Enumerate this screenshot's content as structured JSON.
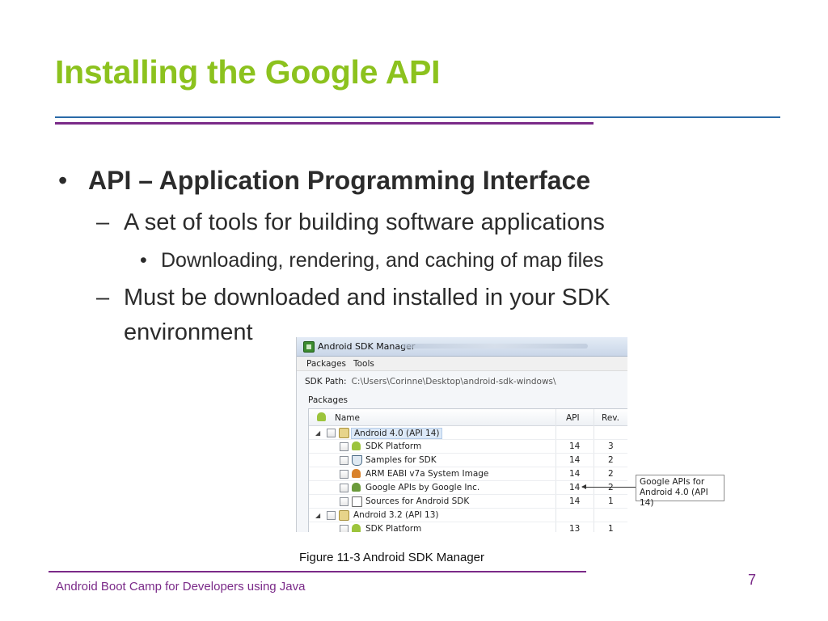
{
  "slide": {
    "title": "Installing the Google API",
    "bullets": {
      "l1": {
        "marker": "•",
        "text": "API – Application Programming Interface"
      },
      "l2a": {
        "marker": "–",
        "text": "A set of tools for building software applications"
      },
      "l3": {
        "marker": "•",
        "text": "Downloading, rendering, and caching of map files"
      },
      "l2b": {
        "marker": "–",
        "text": "Must be downloaded and installed in your SDK",
        "cont": "environment"
      }
    },
    "caption": "Figure 11-3 Android SDK Manager",
    "footer": "Android Boot Camp for Developers using Java",
    "page_number": "7",
    "colors": {
      "title": "#8cc21e",
      "accent_purple": "#7a2a88",
      "accent_blue": "#2a6aa8"
    }
  },
  "sdk_manager": {
    "window_title": "Android SDK Manager",
    "menu": [
      "Packages",
      "Tools"
    ],
    "sdk_path_label": "SDK Path:",
    "sdk_path_value": "C:\\Users\\Corinne\\Desktop\\android-sdk-windows\\",
    "packages_label": "Packages",
    "columns": {
      "name": "Name",
      "api": "API",
      "rev": "Rev."
    },
    "rows": [
      {
        "name": "Android 4.0 (API 14)",
        "api": "",
        "rev": "",
        "icon": "folder-icon",
        "group": true
      },
      {
        "name": "SDK Platform",
        "api": "14",
        "rev": "3",
        "icon": "android-icon"
      },
      {
        "name": "Samples for SDK",
        "api": "14",
        "rev": "2",
        "icon": "flask-icon"
      },
      {
        "name": "ARM EABI v7a System Image",
        "api": "14",
        "rev": "2",
        "icon": "android-icon"
      },
      {
        "name": "Google APIs by Google Inc.",
        "api": "14",
        "rev": "2",
        "icon": "google-api-icon"
      },
      {
        "name": "Sources for Android SDK",
        "api": "14",
        "rev": "1",
        "icon": "document-icon"
      },
      {
        "name": "Android 3.2 (API 13)",
        "api": "",
        "rev": "",
        "icon": "folder-icon",
        "group": true
      },
      {
        "name": "SDK Platform",
        "api": "13",
        "rev": "1",
        "icon": "android-icon"
      }
    ],
    "callout": {
      "line1": "Google APIs for",
      "line2": "Android 4.0 (API 14)"
    }
  }
}
